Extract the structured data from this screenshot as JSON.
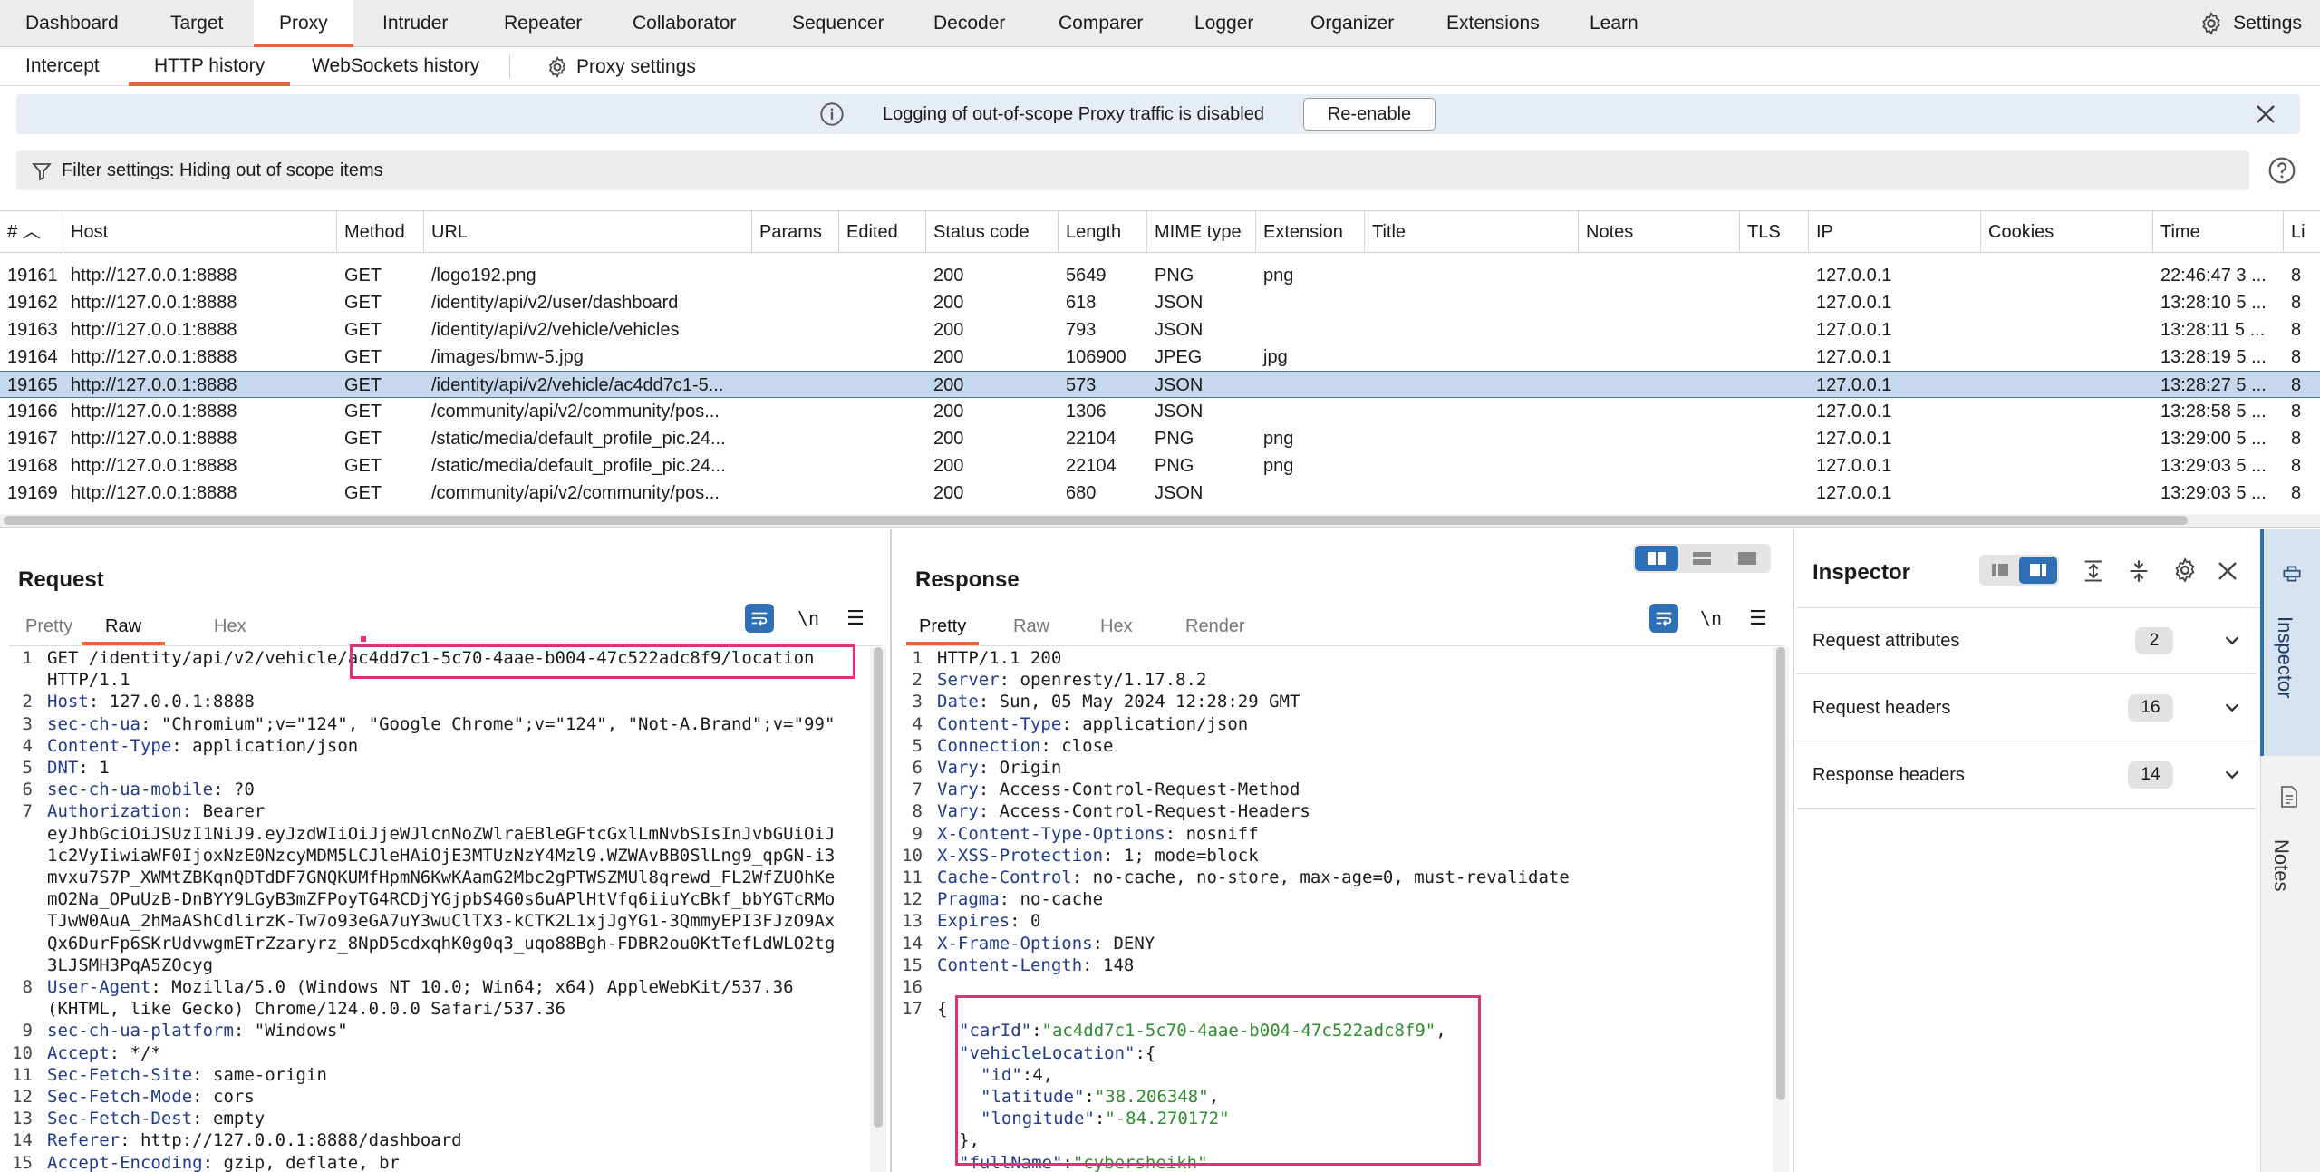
{
  "main_tabs": [
    "Dashboard",
    "Target",
    "Proxy",
    "Intruder",
    "Repeater",
    "Collaborator",
    "Sequencer",
    "Decoder",
    "Comparer",
    "Logger",
    "Organizer",
    "Extensions",
    "Learn"
  ],
  "settings_label": "Settings",
  "sub_tabs": [
    "Intercept",
    "HTTP history",
    "WebSockets history"
  ],
  "proxy_settings_label": "Proxy settings",
  "banner": {
    "message": "Logging of out-of-scope Proxy traffic is disabled",
    "button": "Re-enable"
  },
  "filter": {
    "label": "Filter settings: Hiding out of scope items"
  },
  "table": {
    "columns": [
      "#",
      "Host",
      "Method",
      "URL",
      "Params",
      "Edited",
      "Status code",
      "Length",
      "MIME type",
      "Extension",
      "Title",
      "Notes",
      "TLS",
      "IP",
      "Cookies",
      "Time",
      "Li"
    ],
    "rows": [
      {
        "num": "19161",
        "host": "http://127.0.0.1:8888",
        "method": "GET",
        "url": "/logo192.png",
        "status": "200",
        "length": "5649",
        "mime": "PNG",
        "ext": "png",
        "ip": "127.0.0.1",
        "time": "22:46:47 3 ...",
        "li": "8"
      },
      {
        "num": "19162",
        "host": "http://127.0.0.1:8888",
        "method": "GET",
        "url": "/identity/api/v2/user/dashboard",
        "status": "200",
        "length": "618",
        "mime": "JSON",
        "ext": "",
        "ip": "127.0.0.1",
        "time": "13:28:10 5 ...",
        "li": "8"
      },
      {
        "num": "19163",
        "host": "http://127.0.0.1:8888",
        "method": "GET",
        "url": "/identity/api/v2/vehicle/vehicles",
        "status": "200",
        "length": "793",
        "mime": "JSON",
        "ext": "",
        "ip": "127.0.0.1",
        "time": "13:28:11 5 ...",
        "li": "8"
      },
      {
        "num": "19164",
        "host": "http://127.0.0.1:8888",
        "method": "GET",
        "url": "/images/bmw-5.jpg",
        "status": "200",
        "length": "106900",
        "mime": "JPEG",
        "ext": "jpg",
        "ip": "127.0.0.1",
        "time": "13:28:19 5 ...",
        "li": "8"
      },
      {
        "num": "19165",
        "host": "http://127.0.0.1:8888",
        "method": "GET",
        "url": "/identity/api/v2/vehicle/ac4dd7c1-5...",
        "status": "200",
        "length": "573",
        "mime": "JSON",
        "ext": "",
        "ip": "127.0.0.1",
        "time": "13:28:27 5 ...",
        "li": "8"
      },
      {
        "num": "19166",
        "host": "http://127.0.0.1:8888",
        "method": "GET",
        "url": "/community/api/v2/community/pos...",
        "status": "200",
        "length": "1306",
        "mime": "JSON",
        "ext": "",
        "ip": "127.0.0.1",
        "time": "13:28:58 5 ...",
        "li": "8"
      },
      {
        "num": "19167",
        "host": "http://127.0.0.1:8888",
        "method": "GET",
        "url": "/static/media/default_profile_pic.24...",
        "status": "200",
        "length": "22104",
        "mime": "PNG",
        "ext": "png",
        "ip": "127.0.0.1",
        "time": "13:29:00 5 ...",
        "li": "8"
      },
      {
        "num": "19168",
        "host": "http://127.0.0.1:8888",
        "method": "GET",
        "url": "/static/media/default_profile_pic.24...",
        "status": "200",
        "length": "22104",
        "mime": "PNG",
        "ext": "png",
        "ip": "127.0.0.1",
        "time": "13:29:03 5 ...",
        "li": "8"
      },
      {
        "num": "19169",
        "host": "http://127.0.0.1:8888",
        "method": "GET",
        "url": "/community/api/v2/community/pos...",
        "status": "200",
        "length": "680",
        "mime": "JSON",
        "ext": "",
        "ip": "127.0.0.1",
        "time": "13:29:03 5 ...",
        "li": "8"
      }
    ]
  },
  "request": {
    "title": "Request",
    "tabs": [
      "Pretty",
      "Raw",
      "Hex"
    ],
    "newline_label": "\\n",
    "line1_prefix": "GET /identity/api/v2/vehicle/",
    "line1_highlight": "ac4dd7c1-5c70-4aae-b004-47c522adc8f9/location",
    "line1_cont": "HTTP/1.1",
    "headers": [
      {
        "n": "2",
        "k": "Host",
        "v": " 127.0.0.1:8888"
      },
      {
        "n": "3",
        "k": "sec-ch-ua",
        "v": " \"Chromium\";v=\"124\", \"Google Chrome\";v=\"124\", \"Not-A.Brand\";v=\"99\""
      },
      {
        "n": "4",
        "k": "Content-Type",
        "v": " application/json"
      },
      {
        "n": "5",
        "k": "DNT",
        "v": " 1"
      },
      {
        "n": "6",
        "k": "sec-ch-ua-mobile",
        "v": " ?0"
      },
      {
        "n": "7",
        "k": "Authorization",
        "v": " Bearer"
      }
    ],
    "token_lines": [
      "eyJhbGciOiJSUzI1NiJ9.eyJzdWIiOiJjeWJlcnNoZWlraEBleGFtcGxlLmNvbSIsInJvbGUiOiJ",
      "1c2VyIiwiaWF0IjoxNzE0NzcyMDM5LCJleHAiOjE3MTUzNzY4Mzl9.WZWAvBB0SlLng9_qpGN-i3",
      "mvxu7S7P_XWMtZBKqnQDTdDF7GNQKUMfHpmN6KwKAamG2Mbc2gPTWSZMUl8qrewd_FL2WfZUOhKe",
      "mO2Na_OPuUzB-DnBYY9LGyB3mZFPoyTG4RCDjYGjpbS4G0s6uAPlHtVfq6iiuYcBkf_bbYGTcRMo",
      "TJwW0AuA_2hMaAShCdlirzK-Tw7o93eGA7uY3wuClTX3-kCTK2L1xjJgYG1-3QmmyEPI3FJzO9Ax",
      "Qx6DurFp6SKrUdvwgmETrZzaryrz_8NpD5cdxqhK0g0q3_uqo88Bgh-FDBR2ou0KtTefLdWLO2tg",
      "3LJSMH3PqA5ZOcyg"
    ],
    "ua_line1": " Mozilla/5.0 (Windows NT 10.0; Win64; x64) AppleWebKit/537.36",
    "ua_line2": "(KHTML, like Gecko) Chrome/124.0.0.0 Safari/537.36",
    "headers2": [
      {
        "n": "9",
        "k": "sec-ch-ua-platform",
        "v": " \"Windows\""
      },
      {
        "n": "10",
        "k": "Accept",
        "v": " */*"
      },
      {
        "n": "11",
        "k": "Sec-Fetch-Site",
        "v": " same-origin"
      },
      {
        "n": "12",
        "k": "Sec-Fetch-Mode",
        "v": " cors"
      },
      {
        "n": "13",
        "k": "Sec-Fetch-Dest",
        "v": " empty"
      },
      {
        "n": "14",
        "k": "Referer",
        "v": " http://127.0.0.1:8888/dashboard"
      },
      {
        "n": "15",
        "k": "Accept-Encoding",
        "v": " gzip, deflate, br"
      }
    ]
  },
  "response": {
    "title": "Response",
    "tabs": [
      "Pretty",
      "Raw",
      "Hex",
      "Render"
    ],
    "newline_label": "\\n",
    "status_line": "HTTP/1.1 200",
    "headers": [
      {
        "n": "2",
        "k": "Server",
        "v": " openresty/1.17.8.2"
      },
      {
        "n": "3",
        "k": "Date",
        "v": " Sun, 05 May 2024 12:28:29 GMT"
      },
      {
        "n": "4",
        "k": "Content-Type",
        "v": " application/json"
      },
      {
        "n": "5",
        "k": "Connection",
        "v": " close"
      },
      {
        "n": "6",
        "k": "Vary",
        "v": " Origin"
      },
      {
        "n": "7",
        "k": "Vary",
        "v": " Access-Control-Request-Method"
      },
      {
        "n": "8",
        "k": "Vary",
        "v": " Access-Control-Request-Headers"
      },
      {
        "n": "9",
        "k": "X-Content-Type-Options",
        "v": " nosniff"
      },
      {
        "n": "10",
        "k": "X-XSS-Protection",
        "v": " 1; mode=block"
      },
      {
        "n": "11",
        "k": "Cache-Control",
        "v": " no-cache, no-store, max-age=0, must-revalidate"
      },
      {
        "n": "12",
        "k": "Pragma",
        "v": " no-cache"
      },
      {
        "n": "13",
        "k": "Expires",
        "v": " 0"
      },
      {
        "n": "14",
        "k": "X-Frame-Options",
        "v": " DENY"
      },
      {
        "n": "15",
        "k": "Content-Length",
        "v": " 148"
      }
    ],
    "body": {
      "carId_key": "\"carId\"",
      "carId_val": "\"ac4dd7c1-5c70-4aae-b004-47c522adc8f9\"",
      "vl_key": "\"vehicleLocation\"",
      "id_key": "\"id\"",
      "id_val": "4",
      "lat_key": "\"latitude\"",
      "lat_val": "\"38.206348\"",
      "lon_key": "\"longitude\"",
      "lon_val": "\"-84.270172\"",
      "fn_key": "\"fullName\"",
      "fn_val": "\"cybersheikh\""
    }
  },
  "inspector": {
    "title": "Inspector",
    "sections": [
      {
        "label": "Request attributes",
        "count": "2"
      },
      {
        "label": "Request headers",
        "count": "16"
      },
      {
        "label": "Response headers",
        "count": "14"
      }
    ],
    "side_tabs": [
      "Inspector",
      "Notes"
    ]
  },
  "colors": {
    "accent": "#e8643c",
    "highlight": "#e0307a",
    "selected_row": "#c6d8ee",
    "header_name": "#1e3a8a",
    "json_string": "#2e8b2e"
  }
}
